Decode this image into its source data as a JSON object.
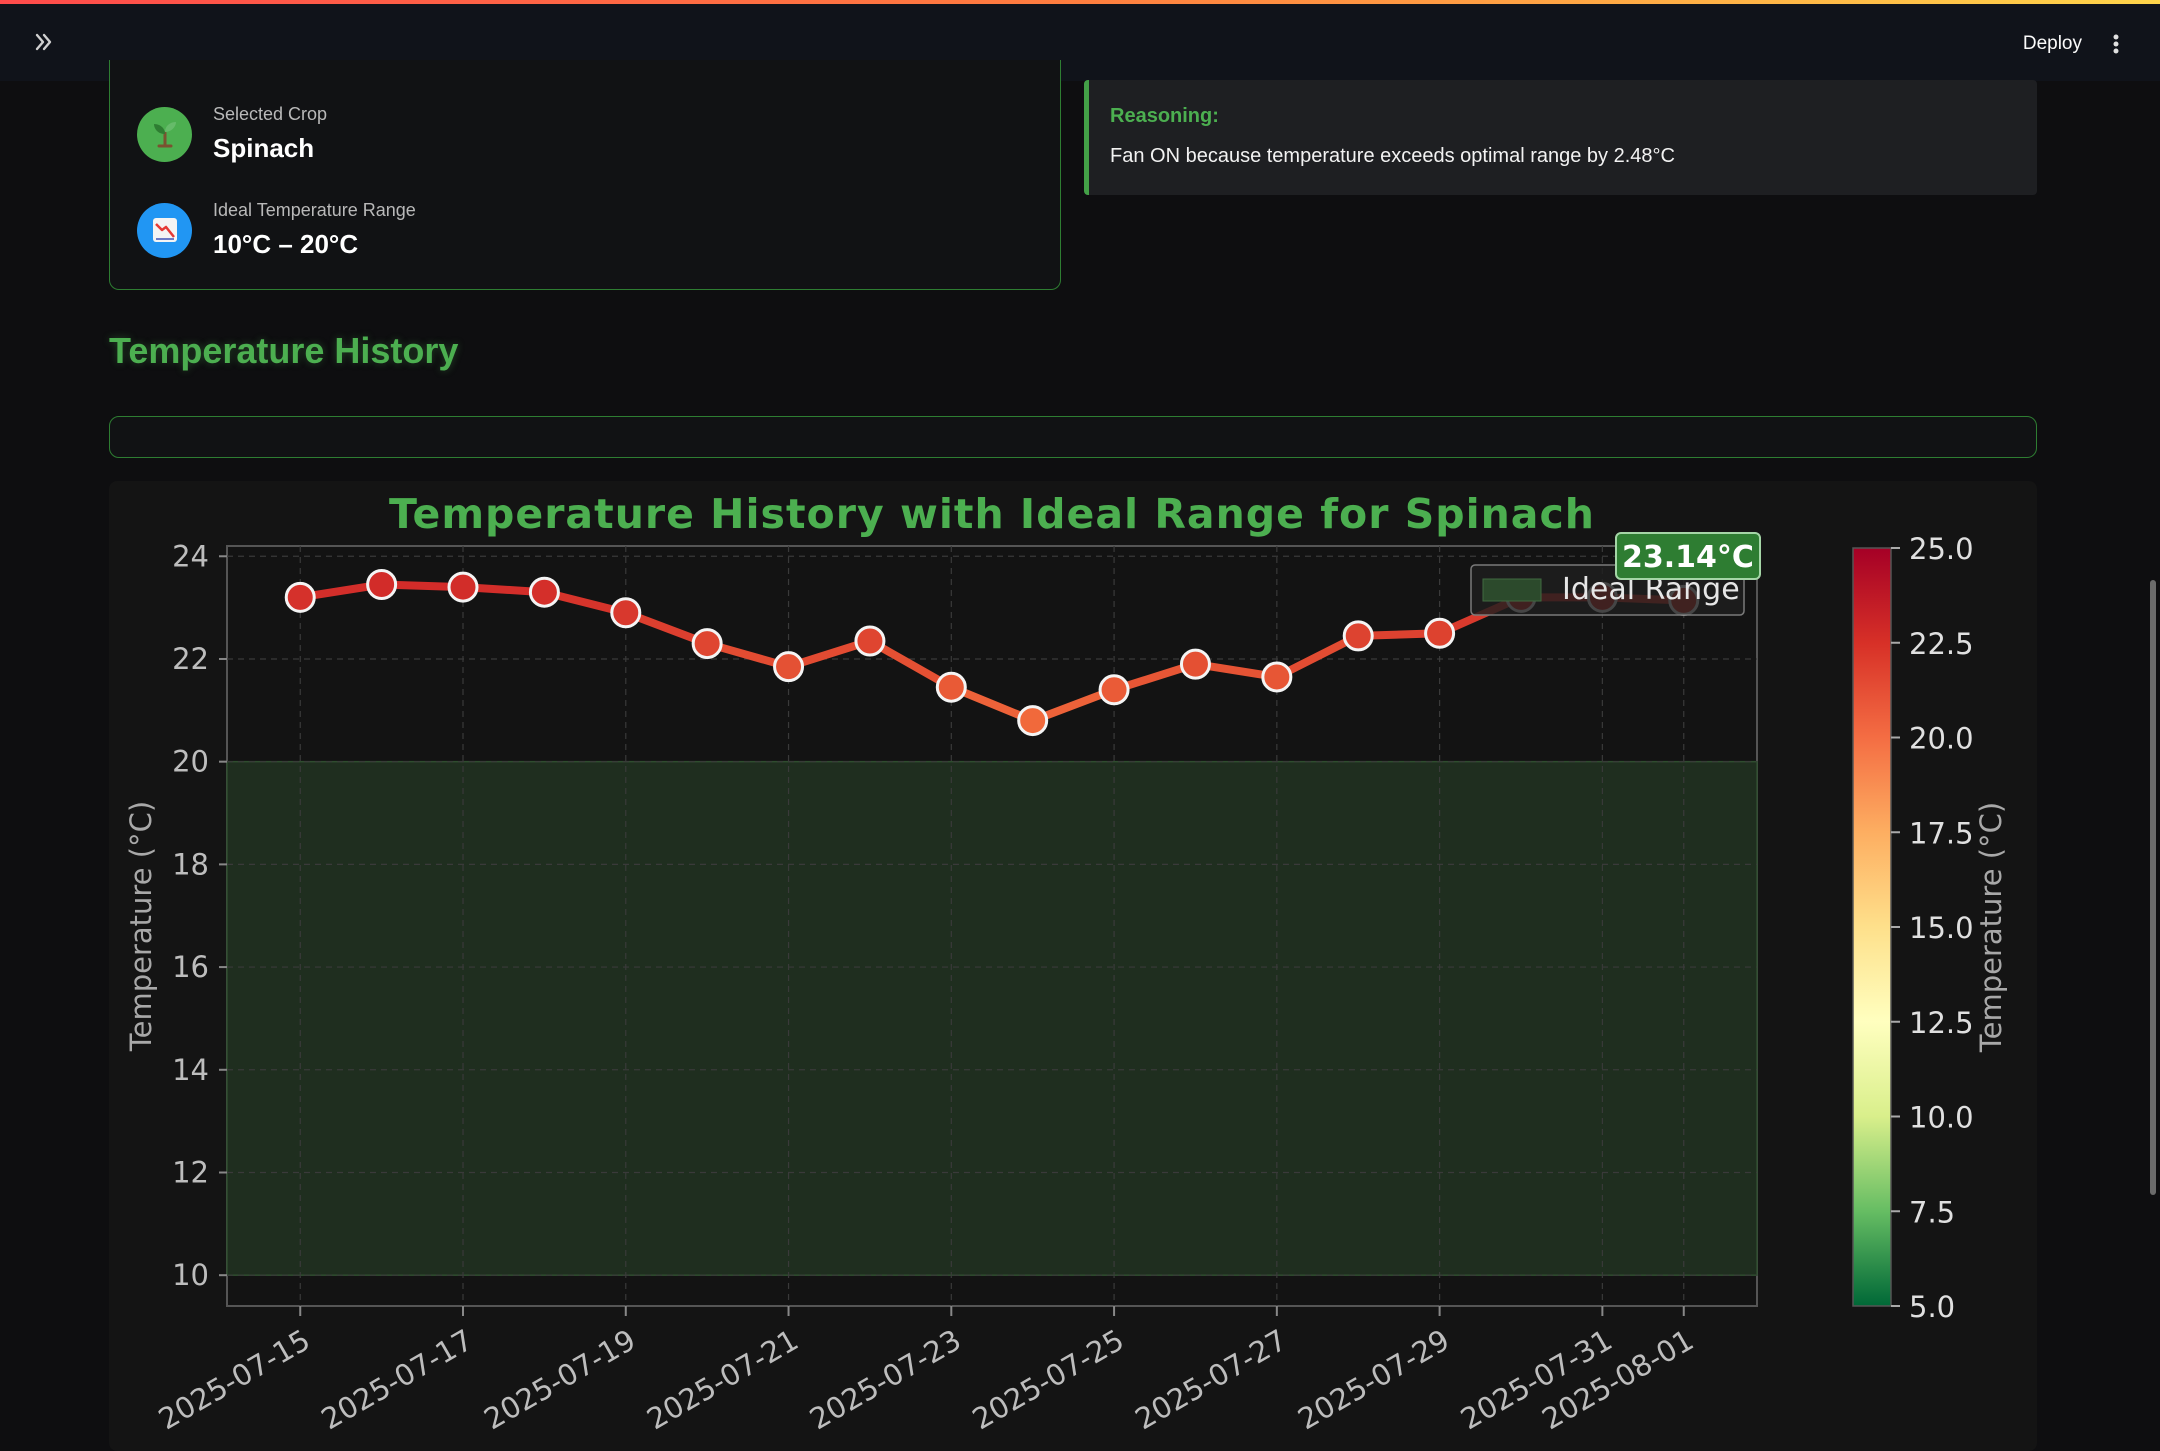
{
  "header": {
    "deploy_label": "Deploy"
  },
  "crop": {
    "selected_label": "Selected Crop",
    "selected_value": "Spinach",
    "range_label": "Ideal Temperature Range",
    "range_value": "10°C – 20°C"
  },
  "reasoning": {
    "title": "Reasoning:",
    "text": "Fan ON because temperature exceeds optimal range by 2.48°C"
  },
  "section": {
    "title": "Temperature History"
  },
  "colors": {
    "accent": "#4caf50",
    "ideal_fill": "#1f2e1f",
    "line": "#e53935"
  },
  "chart_data": {
    "type": "line",
    "title": "Temperature History with Ideal Range for Spinach",
    "ylabel": "Temperature (°C)",
    "xlabel": "",
    "ylim": [
      10,
      24
    ],
    "xlim": [
      "2025-07-15",
      "2025-08-01"
    ],
    "yticks": [
      10,
      12,
      14,
      16,
      18,
      20,
      22,
      24
    ],
    "xticks": [
      "2025-07-15",
      "2025-07-17",
      "2025-07-19",
      "2025-07-21",
      "2025-07-23",
      "2025-07-25",
      "2025-07-27",
      "2025-07-29",
      "2025-07-31",
      "2025-08-01"
    ],
    "x": [
      "2025-07-15",
      "2025-07-16",
      "2025-07-17",
      "2025-07-18",
      "2025-07-19",
      "2025-07-20",
      "2025-07-21",
      "2025-07-22",
      "2025-07-23",
      "2025-07-24",
      "2025-07-25",
      "2025-07-26",
      "2025-07-27",
      "2025-07-28",
      "2025-07-29",
      "2025-07-30",
      "2025-07-31",
      "2025-08-01"
    ],
    "values": [
      23.2,
      23.45,
      23.4,
      23.3,
      22.9,
      22.3,
      21.85,
      22.35,
      21.45,
      20.8,
      21.4,
      21.9,
      21.65,
      22.45,
      22.5,
      23.2,
      23.2,
      23.14
    ],
    "ideal_range": [
      10,
      20
    ],
    "legend": {
      "label": "Ideal Range",
      "placement": "top-right"
    },
    "annotation": "23.14°C",
    "grid": true,
    "colorbar": {
      "label": "Temperature (°C)",
      "range": [
        5,
        25
      ],
      "ticks": [
        "25.0",
        "22.5",
        "20.0",
        "17.5",
        "15.0",
        "12.5",
        "10.0",
        "7.5",
        "5.0"
      ],
      "colors": [
        "#006837",
        "#66bd63",
        "#d9ef8b",
        "#ffffbf",
        "#fee08b",
        "#fdae61",
        "#f46d43",
        "#d73027",
        "#a50026"
      ]
    }
  }
}
